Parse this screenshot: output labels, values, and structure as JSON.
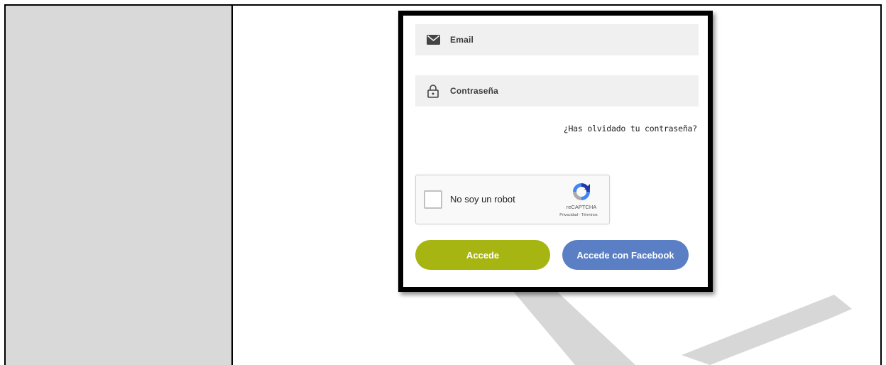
{
  "form": {
    "email_placeholder": "Email",
    "email_icon": "envelope-icon",
    "password_placeholder": "Contraseña",
    "password_icon": "lock-icon",
    "forgot_link": "¿Has olvidado tu contraseña?",
    "captcha": {
      "label": "No soy un robot",
      "brand": "reCAPTCHA",
      "links": "Privacidad - Términos",
      "icon": "recaptcha-logo-icon"
    },
    "login_button": "Accede",
    "facebook_button": "Accede con Facebook"
  },
  "colors": {
    "field_bg": "#f0f0f0",
    "login_button": "#a6b511",
    "facebook_button": "#5b7fc4",
    "left_column": "#d9d9d9",
    "watermark": "#cccccc"
  }
}
